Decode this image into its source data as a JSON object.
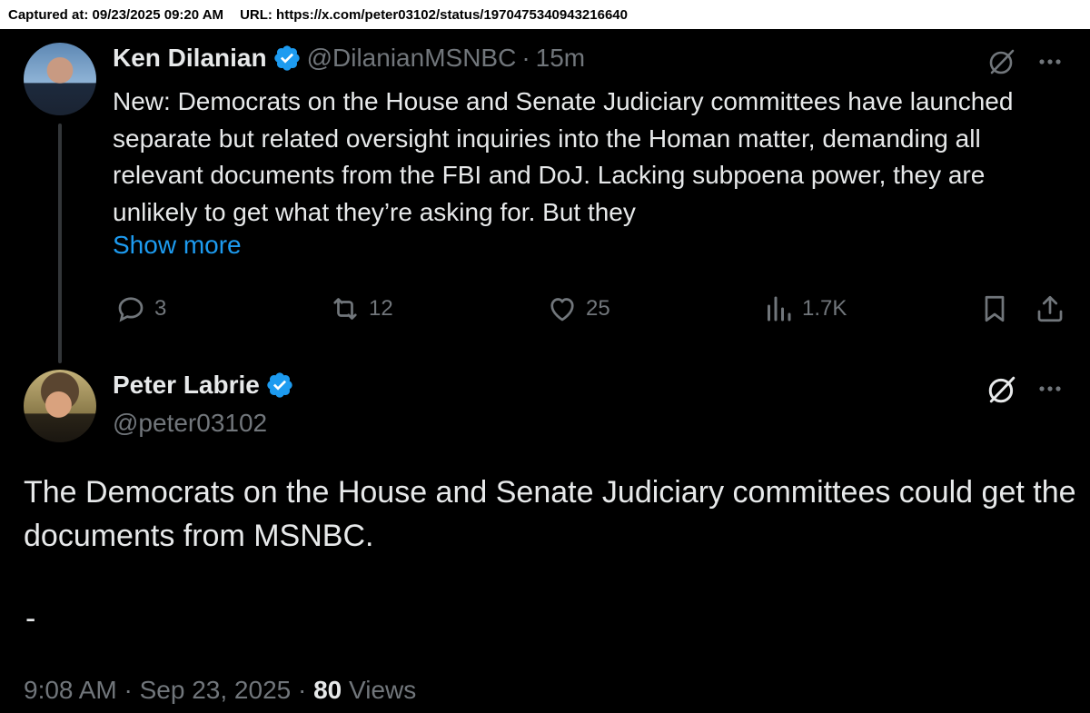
{
  "capture": {
    "captured_at": "Captured at: 09/23/2025 09:20 AM",
    "url": "URL: https://x.com/peter03102/status/1970475340943216640"
  },
  "quoted_tweet": {
    "author_name": "Ken Dilanian",
    "handle": "@DilanianMSNBC",
    "separator": "·",
    "time": "15m",
    "text": "New: Democrats on the House and Senate Judiciary committees have launched separate but related oversight inquiries into the Homan matter, demanding all relevant documents from the FBI and DoJ. Lacking subpoena power, they are unlikely to get what they’re asking for. But they",
    "show_more": "Show more",
    "actions": {
      "replies": "3",
      "reposts": "12",
      "likes": "25",
      "views": "1.7K"
    }
  },
  "reply_tweet": {
    "author_name": "Peter Labrie",
    "handle": "@peter03102",
    "text": "The Democrats on the House and Senate Judiciary committees could get the documents from MSNBC.",
    "dash": "-",
    "footer": {
      "time": "9:08 AM",
      "sep1": "·",
      "date": "Sep 23, 2025",
      "sep2": "·",
      "views_count": "80",
      "views_label": "Views"
    }
  },
  "colors": {
    "background": "#000000",
    "text": "#e7e9ea",
    "muted": "#71767b",
    "link": "#1d9bf0",
    "verified": "#1d9bf0"
  }
}
